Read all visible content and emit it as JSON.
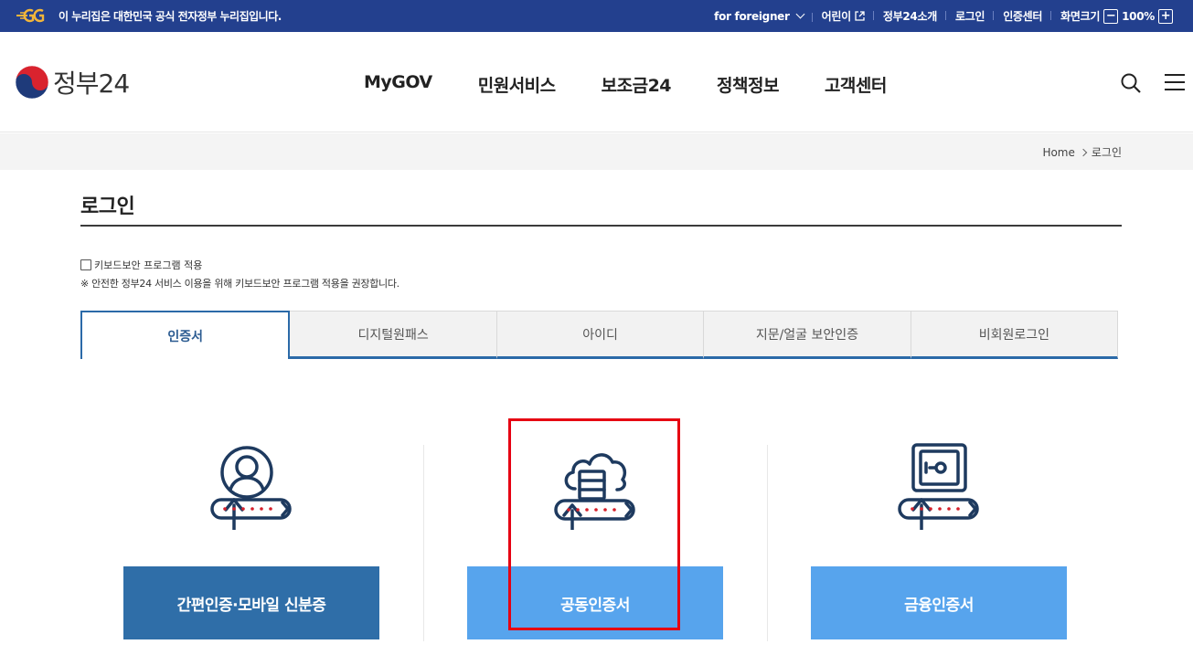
{
  "topbar": {
    "notice": "이 누리집은 대한민국 공식 전자정부 누리집입니다.",
    "foreigner": "for foreigner",
    "kids": "어린이",
    "intro": "정부24소개",
    "login": "로그인",
    "cert_center": "인증센터",
    "zoom_label": "화면크기",
    "zoom_minus": "−",
    "zoom_value": "100%",
    "zoom_plus": "+"
  },
  "header": {
    "logo_text": "정부24",
    "nav": [
      "MyGOV",
      "민원서비스",
      "보조금24",
      "정책정보",
      "고객센터"
    ]
  },
  "breadcrumb": {
    "home": "Home",
    "current": "로그인"
  },
  "page": {
    "title": "로그인",
    "keyboard_checkbox_label": "키보드보안 프로그램 적용",
    "keyboard_note": "※ 안전한 정부24 서비스 이용을 위해 키보드보안 프로그램 적용을 권장합니다."
  },
  "tabs": [
    "인증서",
    "디지털원패스",
    "아이디",
    "지문/얼굴 보안인증",
    "비회원로그인"
  ],
  "active_tab": "인증서",
  "cards": [
    {
      "icon": "person-icon",
      "button": "간편인증·모바일 신분증"
    },
    {
      "icon": "cloud-server-icon",
      "button": "공동인증서"
    },
    {
      "icon": "safe-icon",
      "button": "금융인증서"
    }
  ],
  "colors": {
    "topbar": "#23408e",
    "tab_accent": "#2b6aa8",
    "btn_dark": "#2f6ea8",
    "btn_light": "#57a4ed",
    "highlight": "#e60012",
    "icon_navy": "#1e3a5f"
  }
}
